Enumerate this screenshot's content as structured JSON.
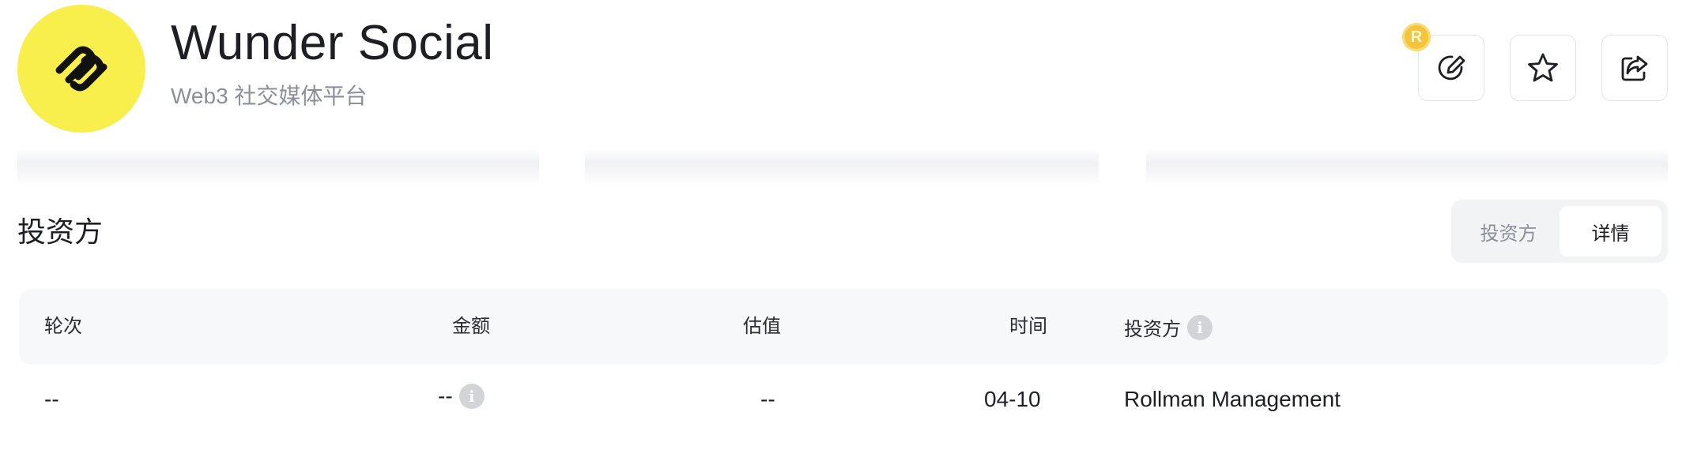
{
  "header": {
    "title": "Wunder Social",
    "subtitle": "Web3 社交媒体平台",
    "logo_icon": "link-chain-logo",
    "coin_badge": "R"
  },
  "actions": {
    "edit_icon": "edit-pen-icon",
    "star_icon": "star-icon",
    "share_icon": "share-icon"
  },
  "section": {
    "title": "投资方",
    "toggle": [
      {
        "label": "投资方",
        "active": false
      },
      {
        "label": "详情",
        "active": true
      }
    ]
  },
  "table": {
    "headers": {
      "round": "轮次",
      "amount": "金额",
      "valuation": "估值",
      "time": "时间",
      "investor": "投资方"
    },
    "rows": [
      {
        "round": "--",
        "amount": "--",
        "valuation": "--",
        "time": "04-10",
        "investor": "Rollman Management"
      }
    ]
  },
  "colors": {
    "logo_bg": "#f8ef4c",
    "coin": "#f4c43a",
    "muted_text": "#8a8f99",
    "table_head_bg": "#f7f8fa"
  }
}
